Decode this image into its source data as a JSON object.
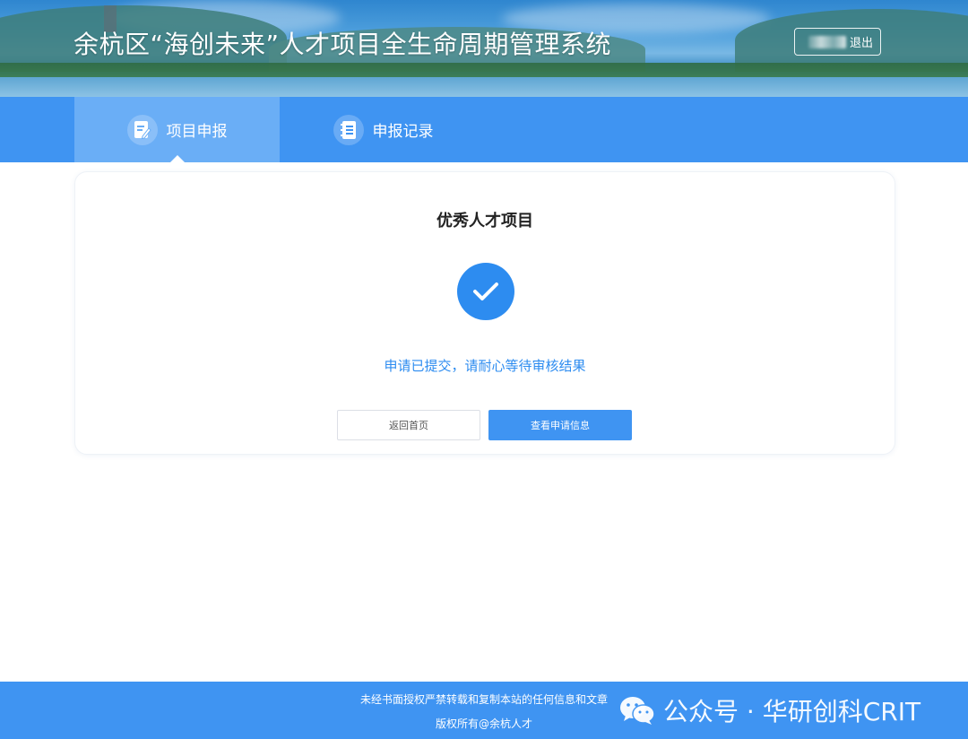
{
  "header": {
    "title": "余杭区“海创未来”人才项目全生命周期管理系统",
    "user_name": "",
    "logout_label": "退出"
  },
  "nav": {
    "tabs": [
      {
        "label": "项目申报",
        "icon": "edit-document-icon",
        "active": true
      },
      {
        "label": "申报记录",
        "icon": "record-book-icon",
        "active": false
      }
    ]
  },
  "main": {
    "card_title": "优秀人才项目",
    "status_icon": "check-circle-icon",
    "status_message": "申请已提交，请耐心等待审核结果",
    "back_button_label": "返回首页",
    "view_button_label": "查看申请信息"
  },
  "footer": {
    "notice": "未经书面授权严禁转载和复制本站的任何信息和文章",
    "copyright": "版权所有@余杭人才"
  },
  "watermark": {
    "text": "公众号 · 华研创科CRIT",
    "icon": "wechat-icon"
  },
  "colors": {
    "primary": "#3f94f2",
    "active_tab": "#6aaef6",
    "success": "#2d8cf0",
    "text_dark": "#222222"
  }
}
